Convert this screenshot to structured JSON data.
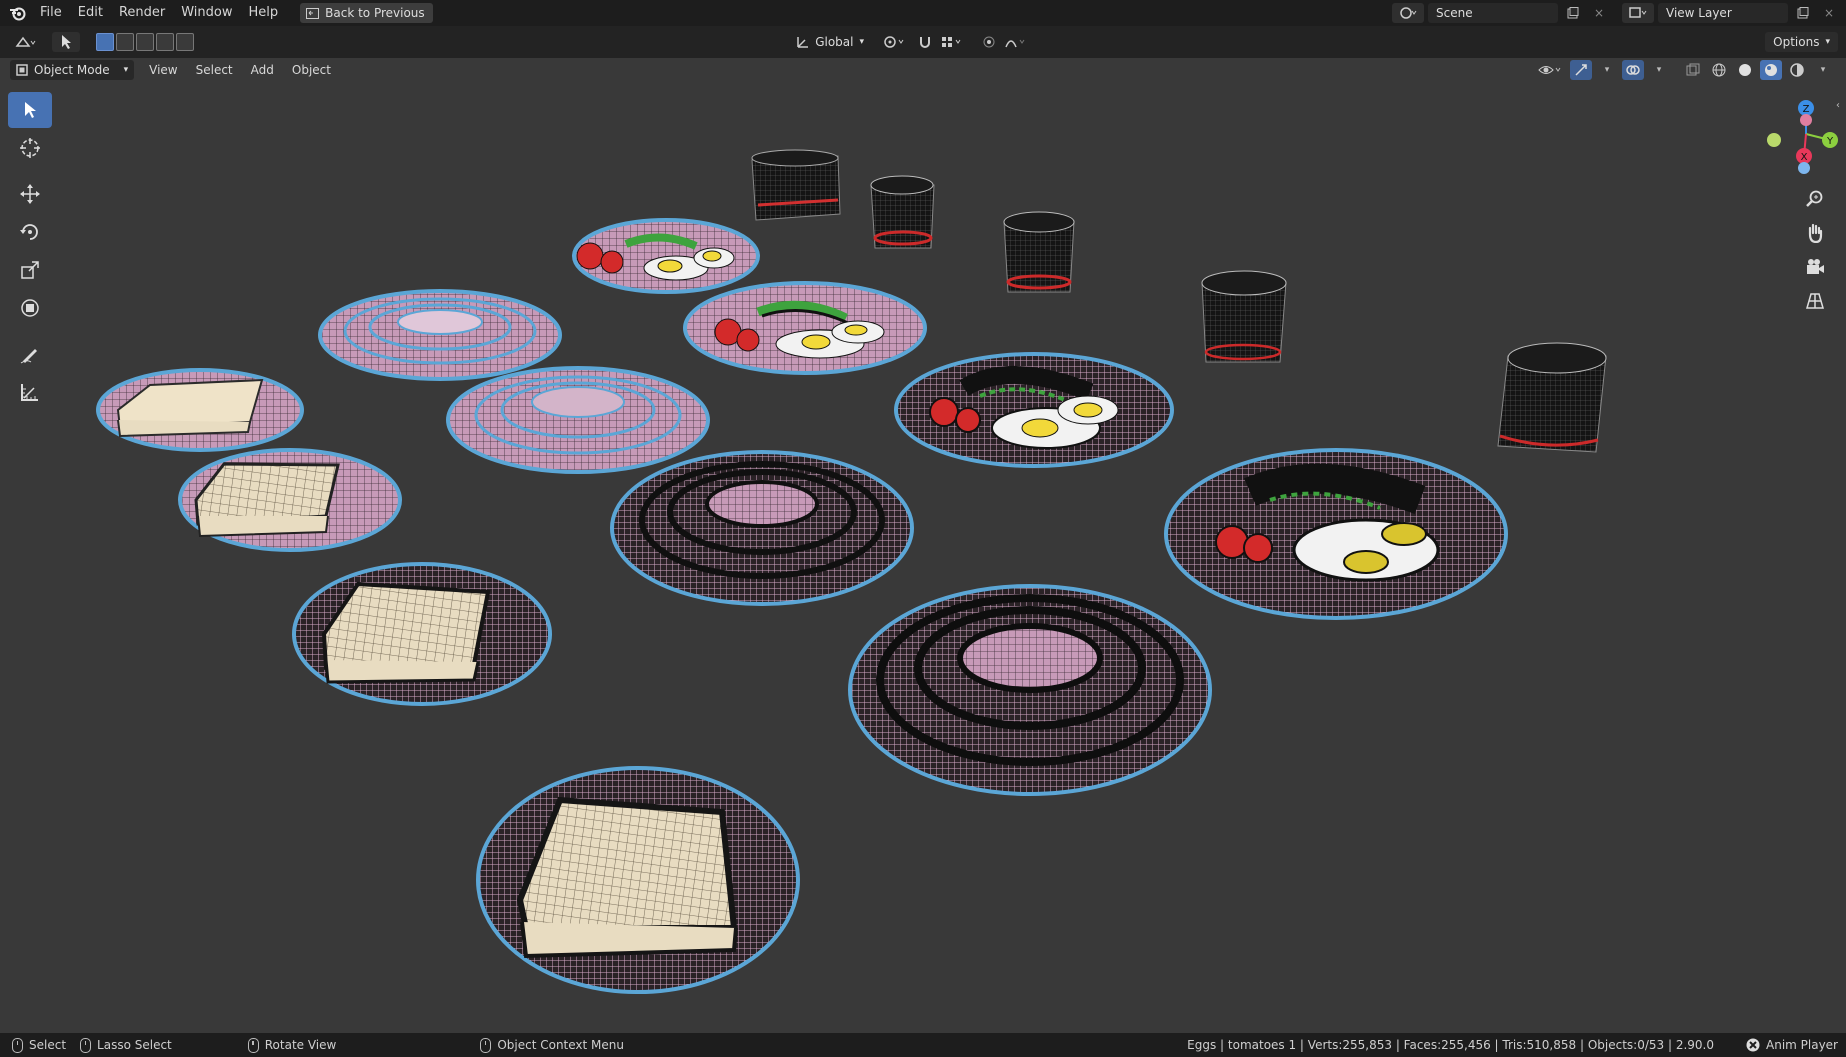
{
  "topbar": {
    "menus": [
      "File",
      "Edit",
      "Render",
      "Window",
      "Help"
    ],
    "back_button": "Back to Previous",
    "scene_label": "Scene",
    "view_layer_label": "View Layer"
  },
  "tool_header": {
    "transform_orientation": "Global",
    "options_label": "Options"
  },
  "viewport_header": {
    "mode": "Object Mode",
    "menus": [
      "View",
      "Select",
      "Add",
      "Object"
    ]
  },
  "gizmo": {
    "axes": [
      "Z",
      "Y",
      "X"
    ],
    "colors": {
      "x": "#e8385a",
      "y": "#8ccf3f",
      "z": "#3b8fe8"
    }
  },
  "status": {
    "select_label": "Select",
    "lasso_label": "Lasso Select",
    "rotate_label": "Rotate View",
    "context_label": "Object Context Menu",
    "stats": "Eggs | tomatoes 1 | Verts:255,853 | Faces:255,456 | Tris:510,858 | Objects:0/53 | 2.90.0",
    "anim_player": "Anim Player"
  },
  "colors": {
    "viewport_bg": "#393939",
    "accent": "#4772b3",
    "plate_wire": "#d7a9c8",
    "plate_edge": "#5ba6d6"
  }
}
